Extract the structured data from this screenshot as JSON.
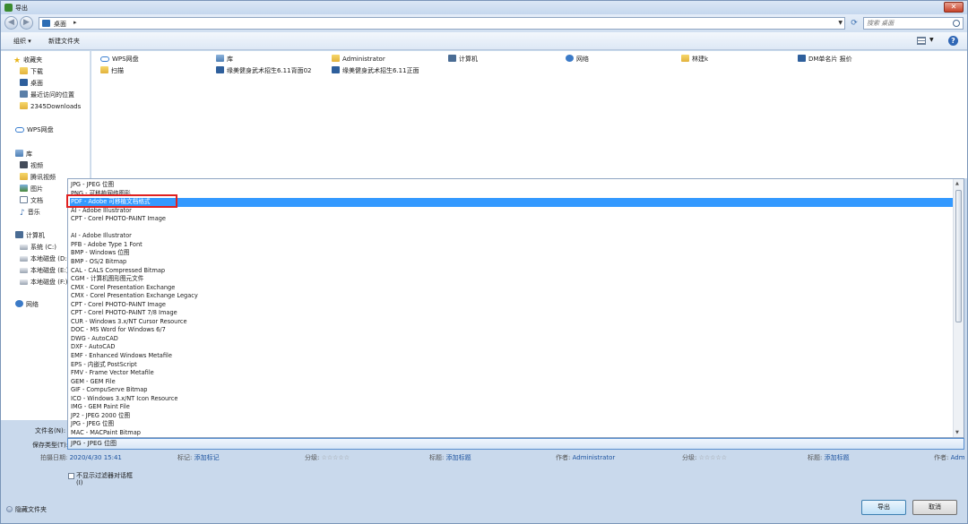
{
  "window": {
    "title": "导出"
  },
  "address": {
    "location": "桌面",
    "search_placeholder": "搜索 桌面"
  },
  "toolbar": {
    "organize": "组织 ▾",
    "new_folder": "新建文件夹"
  },
  "sidebar": {
    "favorites": "收藏夹",
    "fav_items": [
      "下载",
      "桌面",
      "最近访问的位置",
      "2345Downloads"
    ],
    "wps": "WPS网盘",
    "library": "库",
    "lib_items": [
      "视频",
      "腾讯视频",
      "图片",
      "文档",
      "音乐"
    ],
    "computer": "计算机",
    "drives": [
      "系统 (C:)",
      "本地磁盘 (D:)",
      "本地磁盘 (E:)",
      "本地磁盘 (F:)"
    ],
    "network": "网络"
  },
  "files": {
    "row1": [
      "WPS网盘",
      "库",
      "Administrator",
      "计算机",
      "网络",
      "林建k",
      "DM单名片 报价"
    ],
    "row2": [
      "扫描",
      "缘美健身武术招生6.11背面02",
      "缘美健身武术招生6.11正面"
    ]
  },
  "filetypes": {
    "options": [
      "JPG - JPEG 位图",
      "PNG - 可移植网络图形",
      "PDF - Adobe 可移植文档格式",
      "AI - Adobe Illustrator",
      "CPT - Corel PHOTO-PAINT Image",
      "",
      "AI - Adobe Illustrator",
      "PFB - Adobe Type 1 Font",
      "BMP - Windows 位图",
      "BMP - OS/2 Bitmap",
      "CAL - CALS Compressed Bitmap",
      "CGM - 计算机图形图元文件",
      "CMX - Corel Presentation Exchange",
      "CMX - Corel Presentation Exchange Legacy",
      "CPT - Corel PHOTO-PAINT Image",
      "CPT - Corel PHOTO-PAINT 7/8 Image",
      "CUR - Windows 3.x/NT Cursor Resource",
      "DOC - MS Word for Windows 6/7",
      "DWG - AutoCAD",
      "DXF - AutoCAD",
      "EMF - Enhanced Windows Metafile",
      "EPS - 内嵌式 PostScript",
      "FMV - Frame Vector Metafile",
      "GEM - GEM File",
      "GIF - CompuServe Bitmap",
      "ICO - Windows 3.x/NT Icon Resource",
      "IMG - GEM Paint File",
      "JP2 - JPEG 2000 位图",
      "JPG - JPEG 位图",
      "MAC - MACPaint Bitmap"
    ],
    "selected": "PDF - Adobe 可移植文档格式"
  },
  "form": {
    "filename_label": "文件名(N):",
    "savetype_label": "保存类型(T):",
    "savetype_value": "JPG - JPEG 位图"
  },
  "meta": {
    "date_label": "拍摄日期:",
    "date_value": "2020/4/30 15:41",
    "tags_label": "标记:",
    "tags_value": "添加标记",
    "rating_label": "分级:",
    "stars": "☆☆☆☆☆",
    "title_label": "标题:",
    "title_value": "添加标题",
    "author_label": "作者:",
    "author_value": "Administrator",
    "rating2_label": "分级:",
    "title2_label": "标题:",
    "title2_value": "添加标题",
    "author2_label": "作者:",
    "author2_value": "Adm"
  },
  "options": {
    "no_filter_label": "不显示过滤器对话框",
    "no_filter_sub": "(I)"
  },
  "footer": {
    "hide_folders": "隐藏文件夹",
    "export": "导出",
    "cancel": "取消"
  }
}
